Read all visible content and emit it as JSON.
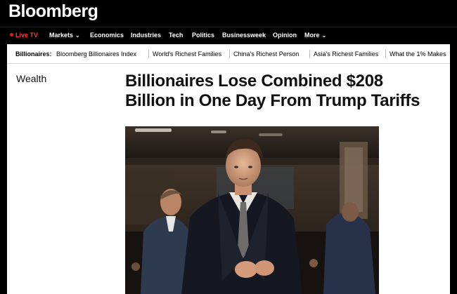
{
  "brand": {
    "logo_text": "Bloomberg"
  },
  "nav": {
    "live_tv": "Live TV",
    "items": [
      "Markets",
      "Economics",
      "Industries",
      "Tech",
      "Politics",
      "Businessweek",
      "Opinion",
      "More"
    ]
  },
  "subnav": {
    "label": "Billionaires:",
    "items": [
      "Bloomberg Billionaires Index",
      "World's Richest Families",
      "China's Richest Person",
      "Asia's Richest Families",
      "What the 1% Makes"
    ]
  },
  "article": {
    "section": "Wealth",
    "headline_line1": "Billionaires Lose Combined $208",
    "headline_line2": "Billion in One Day From Trump Tariffs"
  },
  "colors": {
    "live_red": "#e31b23",
    "topbar": "#000000"
  }
}
